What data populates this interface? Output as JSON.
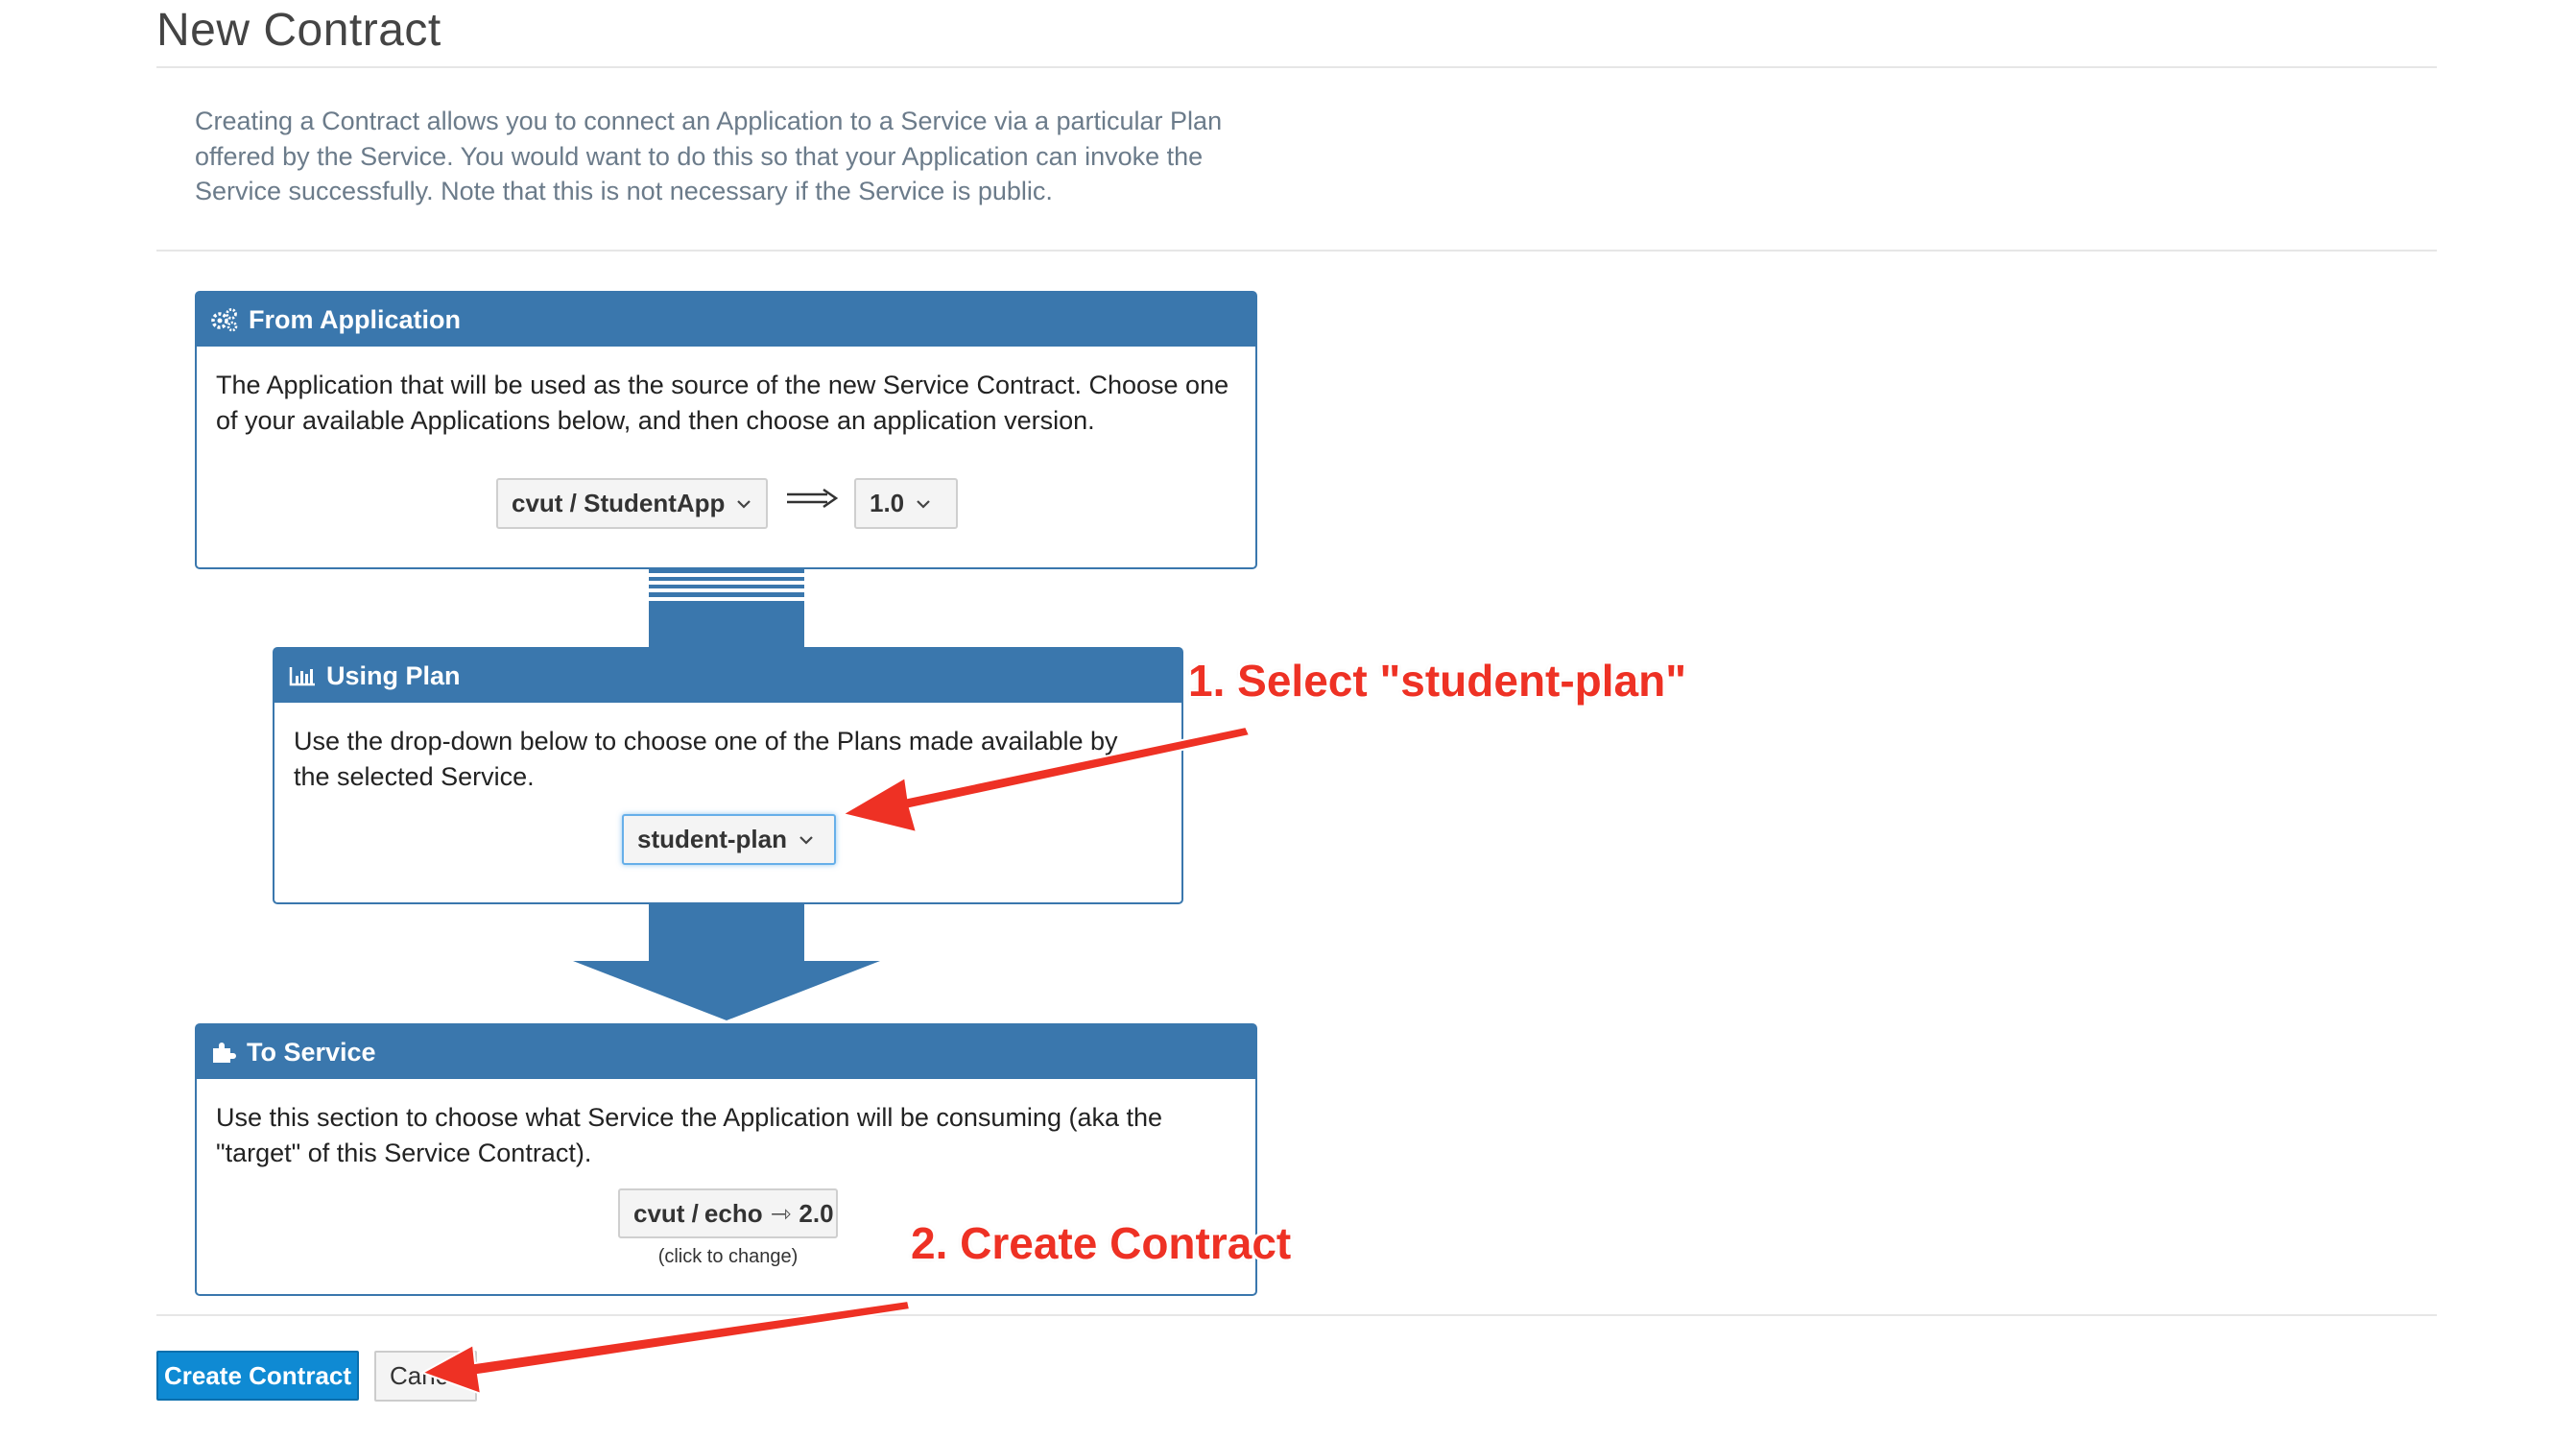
{
  "page": {
    "title": "New Contract",
    "intro": "Creating a Contract allows you to connect an Application to a Service via a particular Plan offered by the Service. You would want to do this so that your Application can invoke the Service successfully. Note that this is not necessary if the Service is public."
  },
  "from_application": {
    "header": "From Application",
    "description": "The Application that will be used as the source of the new Service Contract. Choose one of your available Applications below, and then choose an application version.",
    "app_select": "cvut / StudentApp",
    "version_select": "1.0",
    "icon": "gears-icon"
  },
  "using_plan": {
    "header": "Using Plan",
    "description": "Use the drop-down below to choose one of the Plans made available by the selected Service.",
    "plan_select": "student-plan",
    "icon": "bar-chart-icon"
  },
  "to_service": {
    "header": "To Service",
    "description": "Use this section to choose what Service the Application will be consuming (aka the \"target\" of this Service Contract).",
    "service_org": "cvut / ",
    "service_name": "echo",
    "service_arrow": "⇾",
    "service_version": "2.0",
    "hint": "(click to change)",
    "icon": "puzzle-icon"
  },
  "actions": {
    "create": "Create Contract",
    "cancel": "Cancel"
  },
  "annotations": {
    "step1": "1. Select \"student-plan\"",
    "step2": "2. Create Contract",
    "color": "#ee3124"
  },
  "colors": {
    "panel": "#3a77ad",
    "primary_button": "#0f8ad3"
  }
}
